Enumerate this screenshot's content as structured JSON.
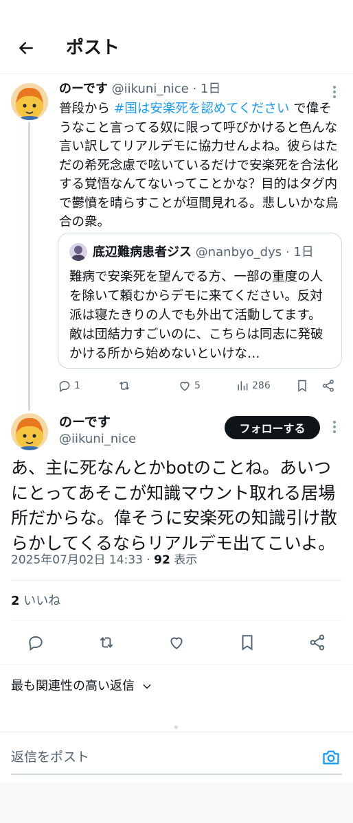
{
  "header": {
    "title": "ポスト"
  },
  "parent_post": {
    "name": "のーです",
    "handle": "@iikuni_nice",
    "time": "1日",
    "text_before": "普段から ",
    "hashtag": "#国は安楽死を認めてください",
    "text_after": " で偉そうなこと言ってる奴に限って呼びかけると色んな言い訳してリアルデモに協力せんよね。彼らはただの希死念慮で呟いているだけで安楽死を合法化する覚悟なんてないってことかな？目的はタグ内で鬱憤を晴らすことが垣間見れる。悲しいかな烏合の衆。",
    "quote": {
      "name": "底辺難病患者ジス",
      "handle": "@nanbyo_dys",
      "time": "1日",
      "text": "難病で安楽死を望んでる方、一部の重度の人を除いて頼むからデモに来てください。反対派は寝たきりの人でも外出て活動してます。敵は団結力すごいのに、こちらは同志に発破かける所から始めないといけな…"
    },
    "metrics": {
      "replies": "1",
      "reposts": "",
      "likes": "5",
      "views": "286"
    }
  },
  "main_post": {
    "name": "のーです",
    "handle": "@iikuni_nice",
    "follow_label": "フォローする",
    "text": "あ、主に死なんとかbotのことね。あいつにとってあそこが知識マウント取れる居場所だからな。偉そうに安楽死の知識引け散らかしてくるならリアルデモ出てこいよ。",
    "timestamp": "2025年07月02日 14:33",
    "separator": " · ",
    "views_count": "92",
    "views_label": " 表示",
    "likes_count": "2",
    "likes_label": " いいね"
  },
  "replies_section": {
    "sort_label": "最も関連性の高い返信"
  },
  "compose": {
    "placeholder": "返信をポスト"
  },
  "colors": {
    "accent": "#1d9bf0",
    "text": "#0f1419",
    "muted": "#536471",
    "border": "#eff3f4"
  },
  "icons": [
    "back-arrow-icon",
    "more-icon",
    "reply-icon",
    "repost-icon",
    "like-icon",
    "views-icon",
    "bookmark-icon",
    "share-icon",
    "chevron-down-icon",
    "camera-icon"
  ]
}
